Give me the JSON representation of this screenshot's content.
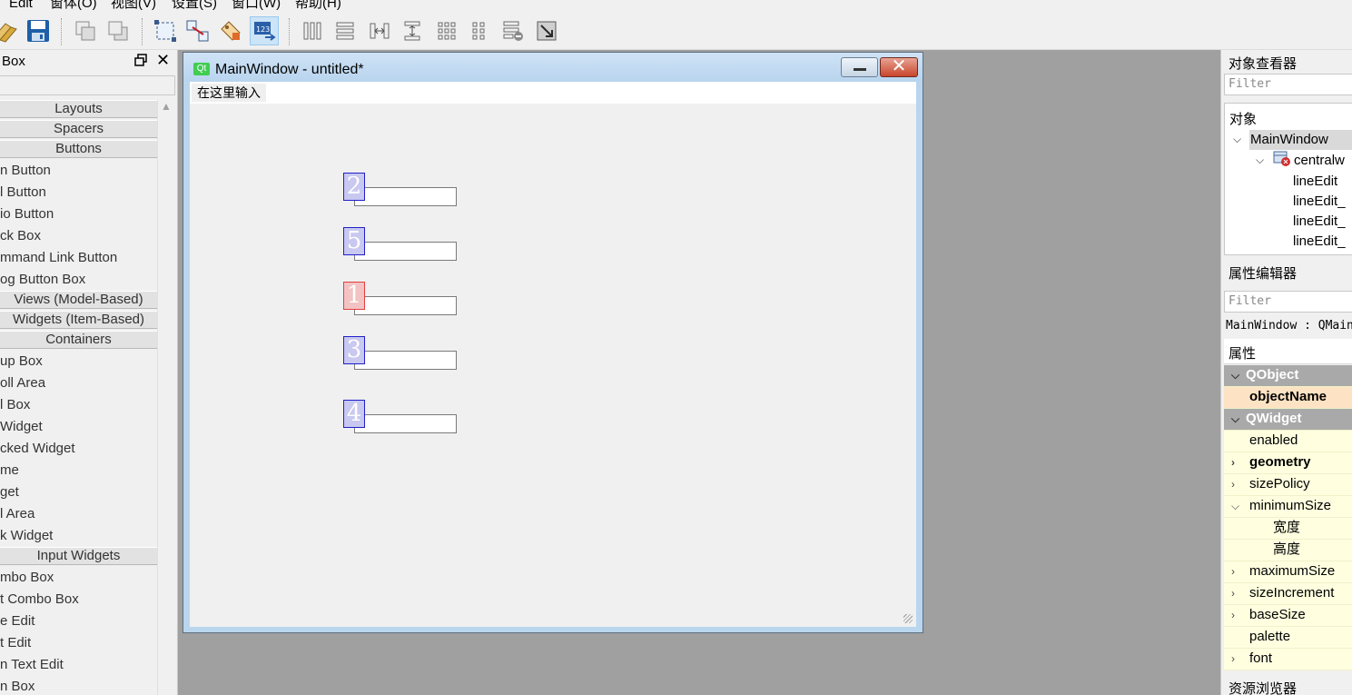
{
  "menubar": {
    "items": [
      "Edit",
      "窗体(O)",
      "视图(V)",
      "设置(S)",
      "窗口(W)",
      "帮助(H)"
    ]
  },
  "toolbar": {
    "icons": [
      "open-icon",
      "save-icon",
      "send-to-back-icon",
      "bring-to-front-icon",
      "edit-widgets-icon",
      "edit-signals-slots-icon",
      "edit-buddies-icon",
      "edit-tab-order-icon",
      "layout-horizontal-icon",
      "layout-vertical-icon",
      "splitter-horizontal-icon",
      "splitter-vertical-icon",
      "layout-grid-icon",
      "layout-form-icon",
      "break-layout-icon",
      "adjust-size-icon"
    ]
  },
  "widgetbox": {
    "title": "Box",
    "categories": {
      "layouts": "Layouts",
      "spacers": "Spacers",
      "buttons": "Buttons",
      "item_views": "Views (Model-Based)",
      "item_widgets": "Widgets (Item-Based)",
      "containers": "Containers",
      "input_widgets": "Input Widgets"
    },
    "buttons_items": [
      "n Button",
      "l Button",
      "io Button",
      "ck Box",
      "mmand Link Button",
      "og Button Box"
    ],
    "containers_items": [
      "up Box",
      "oll Area",
      "l Box",
      " Widget",
      "cked Widget",
      "me",
      "get",
      "l Area",
      "k Widget"
    ],
    "input_items": [
      "mbo Box",
      "t Combo Box",
      "e Edit",
      "t Edit",
      "n Text Edit",
      "n Box"
    ]
  },
  "form": {
    "title": "MainWindow - untitled*",
    "qt_logo": "Qt",
    "menu_placeholder": "在这里输入",
    "tab_order": [
      "2",
      "5",
      "1",
      "3",
      "4"
    ]
  },
  "object_inspector": {
    "title": "对象查看器",
    "filter_placeholder": "Filter",
    "column": "对象",
    "root": "MainWindow",
    "central": "centralw",
    "children": [
      "lineEdit",
      "lineEdit_",
      "lineEdit_",
      "lineEdit_"
    ]
  },
  "property_editor": {
    "title": "属性编辑器",
    "filter_placeholder": "Filter",
    "class_label": "MainWindow : QMain",
    "column": "属性",
    "rows": [
      {
        "label": "QObject"
      },
      {
        "label": "objectName"
      },
      {
        "label": "QWidget"
      },
      {
        "label": "enabled"
      },
      {
        "label": "geometry"
      },
      {
        "label": "sizePolicy"
      },
      {
        "label": "minimumSize"
      },
      {
        "label": "宽度"
      },
      {
        "label": "高度"
      },
      {
        "label": "maximumSize"
      },
      {
        "label": "sizeIncrement"
      },
      {
        "label": "baseSize"
      },
      {
        "label": "palette"
      },
      {
        "label": "font"
      }
    ]
  },
  "resource_browser": {
    "title": "资源浏览器"
  },
  "colors": {
    "tab_badge": "#c8c8f0",
    "tab_badge_current": "#f3c3c3",
    "property_row": "#ffffe0",
    "property_group": "#a9a9a9"
  }
}
